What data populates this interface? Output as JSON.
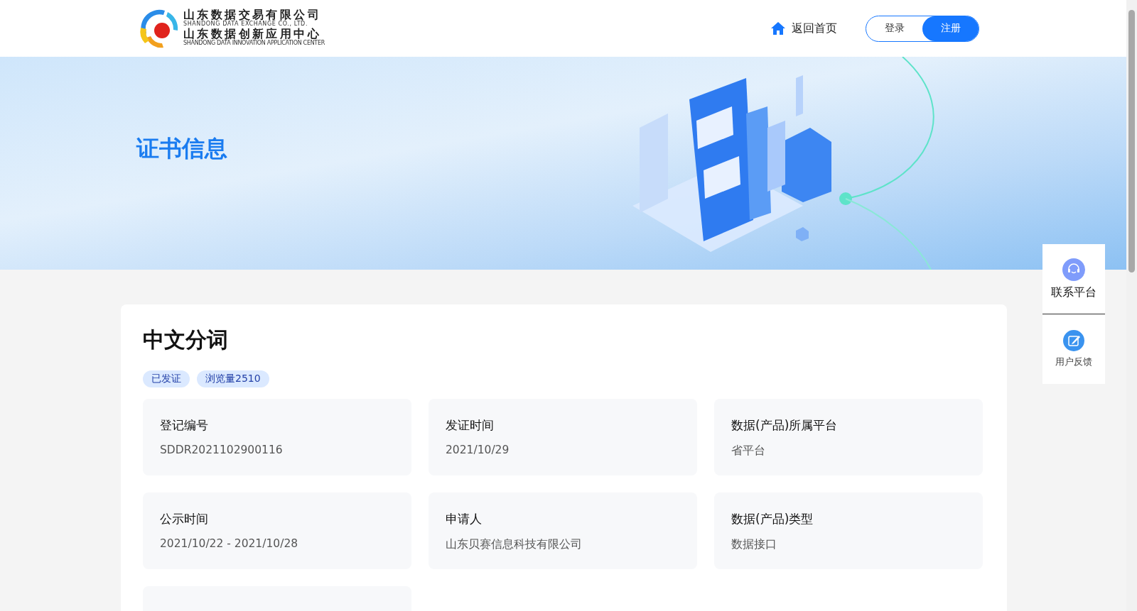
{
  "header": {
    "logo": {
      "line_1": "山东数据交易有限公司",
      "line_2": "SHANDONG DATA EXCHANGE CO., LTD.",
      "line_3": "山东数据创新应用中心",
      "line_4": "SHANDONG DATA INNOVATION APPLICATION CENTER"
    },
    "home_link": "返回首页",
    "auth_buttons": [
      {
        "label": "登录",
        "selected": false
      },
      {
        "label": "注册",
        "selected": true
      }
    ]
  },
  "banner": {
    "title": "证书信息"
  },
  "certificate": {
    "title": "中文分词",
    "tags": [
      "已发证",
      "浏览量2510"
    ],
    "fields": [
      {
        "kind": "field",
        "label": "登记编号",
        "value": "SDDR2021102900116"
      },
      {
        "kind": "field",
        "label": "发证时间",
        "value": "2021/10/29"
      },
      {
        "kind": "field",
        "label": "数据(产品)所属平台",
        "value": "省平台"
      },
      {
        "kind": "field",
        "label": "公示时间",
        "value": "2021/10/22 - 2021/10/28"
      },
      {
        "kind": "field",
        "label": "申请人",
        "value": "山东贝赛信息科技有限公司"
      },
      {
        "kind": "field",
        "label": "数据(产品)类型",
        "value": "数据接口"
      },
      {
        "kind": "cut"
      }
    ]
  },
  "side_widget": [
    {
      "kind": "contact",
      "label": "联系平台"
    },
    {
      "kind": "feedback",
      "label": "用户反馈"
    }
  ]
}
